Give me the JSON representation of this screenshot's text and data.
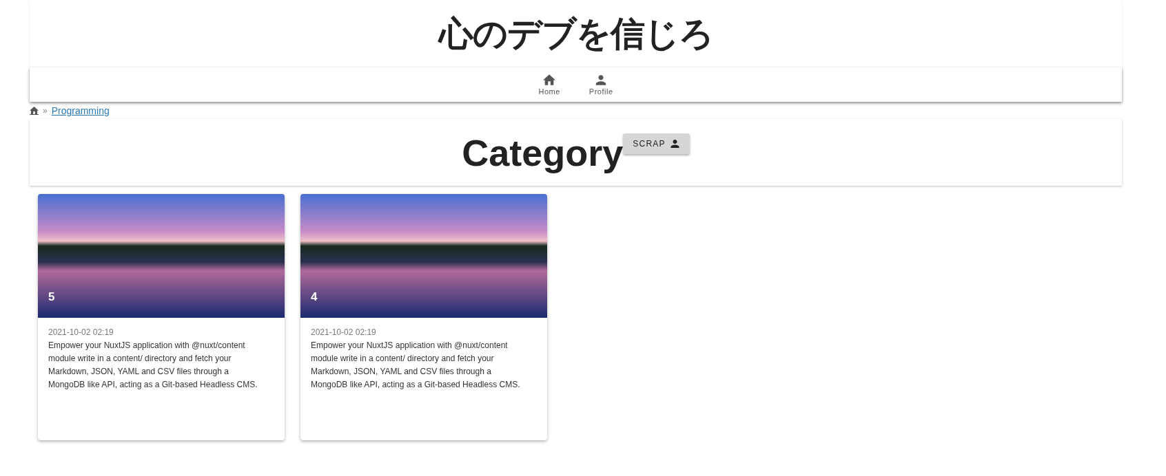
{
  "site_title": "心のデブを信じろ",
  "nav": [
    {
      "label": "Home",
      "kind": "home"
    },
    {
      "label": "Profile",
      "kind": "person"
    }
  ],
  "breadcrumb": {
    "separator": "»",
    "items": [
      "Programming"
    ]
  },
  "heading": "Category",
  "scrap_button": {
    "label": "SCRAP"
  },
  "cards": [
    {
      "title": "5",
      "date": "2021-10-02 02:19",
      "text": "Empower your NuxtJS application with @nuxt/content module write in a content/ directory and fetch your Markdown, JSON, YAML and CSV files through a MongoDB like API, acting as a Git-based Headless CMS."
    },
    {
      "title": "4",
      "date": "2021-10-02 02:19",
      "text": "Empower your NuxtJS application with @nuxt/content module write in a content/ directory and fetch your Markdown, JSON, YAML and CSV files through a MongoDB like API, acting as a Git-based Headless CMS."
    }
  ]
}
